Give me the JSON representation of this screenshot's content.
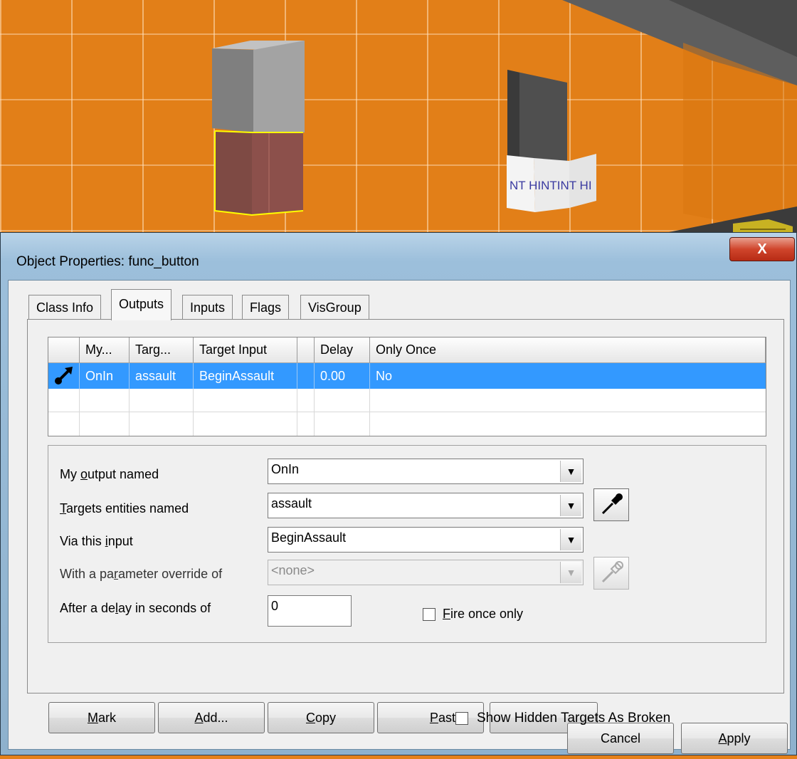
{
  "window": {
    "title": "Object Properties: func_button",
    "close_label": "X"
  },
  "tabs": [
    {
      "label": "Class Info",
      "active": false
    },
    {
      "label": "Outputs",
      "active": true
    },
    {
      "label": "Inputs",
      "active": false
    },
    {
      "label": "Flags",
      "active": false
    },
    {
      "label": "VisGroup",
      "active": false
    }
  ],
  "grid": {
    "columns": [
      "",
      "My...",
      "Targ...",
      "Target Input",
      "",
      "Delay",
      "Only Once"
    ],
    "rows": [
      {
        "icon": "output-connection-icon",
        "my_output": "OnIn",
        "target": "assault",
        "target_input": "BeginAssault",
        "param": "",
        "delay": "0.00",
        "only_once": "No",
        "selected": true
      }
    ]
  },
  "form": {
    "output_label_pre": "My ",
    "output_label_key": "o",
    "output_label_post": "utput named",
    "output_value": "OnIn",
    "targets_label_key": "T",
    "targets_label_post": "argets entities named",
    "targets_value": "assault",
    "input_label_pre": "Via this ",
    "input_label_key": "i",
    "input_label_post": "nput",
    "input_value": "BeginAssault",
    "param_label_pre": "With a pa",
    "param_label_key": "r",
    "param_label_post": "ameter override of",
    "param_value": "<none>",
    "delay_label_pre": "After a de",
    "delay_label_key": "l",
    "delay_label_post": "ay in seconds of",
    "delay_value": "0",
    "fire_once_key": "F",
    "fire_once_post": "ire once only",
    "fire_once_checked": false
  },
  "buttons": {
    "mark_key": "M",
    "mark_post": "ark",
    "add_key": "A",
    "add_post": "dd...",
    "copy_key": "C",
    "copy_post": "opy",
    "paste_key": "P",
    "paste_post": "aste",
    "show_hidden_label": "Show Hidden Targets As Broken",
    "show_hidden_checked": false,
    "cancel": "Cancel",
    "apply_key": "A",
    "apply_post": "pply"
  },
  "viewport": {
    "wall_color": "#e27f18",
    "selection_color": "#ffff00",
    "hint_text": "NT HINTINT HI"
  }
}
